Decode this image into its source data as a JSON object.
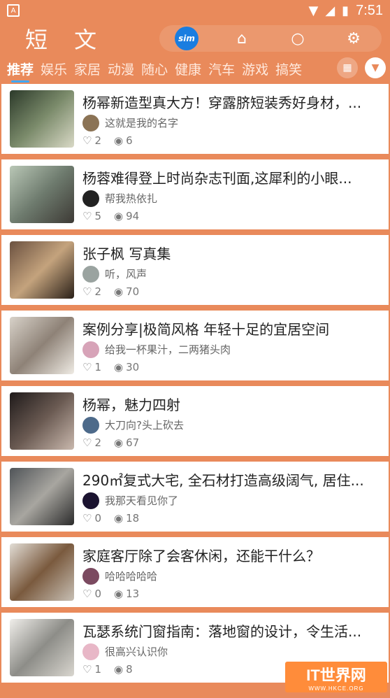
{
  "status": {
    "time": "7:51"
  },
  "app": {
    "logo": "短 文",
    "badge": "sim"
  },
  "tabs": [
    "推荐",
    "娱乐",
    "家居",
    "动漫",
    "随心",
    "健康",
    "汽车",
    "游戏",
    "搞笑"
  ],
  "feed": [
    {
      "title": "杨幂新造型真大方！穿露脐短装秀好身材，...",
      "author": "这就是我的名字",
      "likes": "2",
      "views": "6"
    },
    {
      "title": "杨蓉难得登上时尚杂志刊面,这犀利的小眼...",
      "author": "帮我热依扎",
      "likes": "5",
      "views": "94"
    },
    {
      "title": "张子枫 写真集",
      "author": "听，风声",
      "likes": "2",
      "views": "70"
    },
    {
      "title": "案例分享|极简风格 年轻十足的宜居空间",
      "author": "给我一杯果汁，二两猪头肉",
      "likes": "1",
      "views": "30"
    },
    {
      "title": "杨幂，魅力四射",
      "author": "大刀向?头上砍去",
      "likes": "2",
      "views": "67"
    },
    {
      "title": "290㎡复式大宅, 全石材打造高级阔气, 居住...",
      "author": "我那天看见你了",
      "likes": "0",
      "views": "18"
    },
    {
      "title": "家庭客厅除了会客休闲，还能干什么？",
      "author": "哈哈哈哈哈",
      "likes": "0",
      "views": "13"
    },
    {
      "title": "瓦瑟系统门窗指南：落地窗的设计，令生活...",
      "author": "很高兴认识你",
      "likes": "1",
      "views": "8"
    }
  ],
  "watermark": {
    "main": "IT世界网",
    "sub": "WWW.HKCE.ORG"
  },
  "colors": {
    "accent": "#e98a5b",
    "badge": "#1a7de0"
  }
}
